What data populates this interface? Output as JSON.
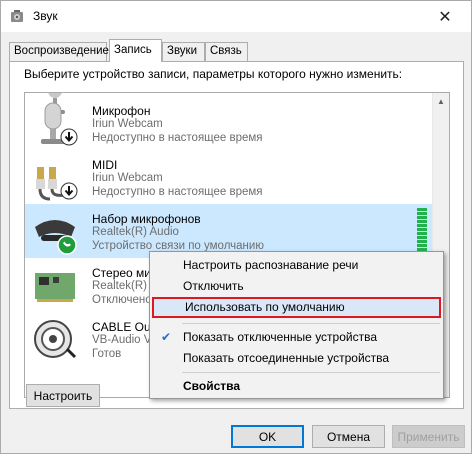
{
  "window": {
    "title": "Звук",
    "close_glyph": "✕"
  },
  "tabs": [
    {
      "label": "Воспроизведение"
    },
    {
      "label": "Запись"
    },
    {
      "label": "Звуки"
    },
    {
      "label": "Связь"
    }
  ],
  "instruction": "Выберите устройство записи, параметры которого нужно изменить:",
  "devices": [
    {
      "name": "Микрофон",
      "sub": "Iriun Webcam",
      "status": "Недоступно в настоящее время",
      "icon": "microphone-icon"
    },
    {
      "name": "MIDI",
      "sub": "Iriun Webcam",
      "status": "Недоступно в настоящее время",
      "icon": "audio-cable-icon"
    },
    {
      "name": "Набор микрофонов",
      "sub": "Realtek(R) Audio",
      "status": "Устройство связи по умолчанию",
      "icon": "microphone-array-icon"
    },
    {
      "name": "Стерео мик",
      "sub": "Realtek(R) A",
      "status": "Отключено",
      "icon": "sound-card-icon"
    },
    {
      "name": "CABLE Outp",
      "sub": "VB-Audio V",
      "status": "Готов",
      "icon": "cable-reel-icon"
    }
  ],
  "context_menu": {
    "items": [
      {
        "label": "Настроить распознавание речи"
      },
      {
        "label": "Отключить"
      },
      {
        "label": "Использовать по умолчанию"
      },
      {
        "label": "Показать отключенные устройства",
        "checked": true
      },
      {
        "label": "Показать отсоединенные устройства"
      },
      {
        "label": "Свойства"
      }
    ],
    "check_glyph": "✔"
  },
  "buttons": {
    "configure": "Настроить",
    "ok": "OK",
    "cancel": "Отмена",
    "apply": "Применить"
  },
  "colors": {
    "selection": "#cce8ff",
    "highlight_border": "#e0171f",
    "level_meter": "#22b14c",
    "default_button_border": "#0078d7"
  }
}
